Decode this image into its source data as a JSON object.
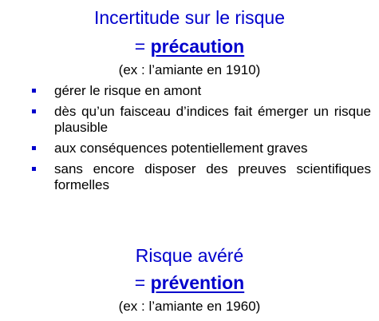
{
  "precaution": {
    "heading": "Incertitude sur le risque",
    "equals": "= ",
    "keyword": "précaution",
    "example": "(ex : l’amiante en 1910)",
    "bullets": [
      "gérer le risque en amont",
      "dès qu’un faisceau d’indices fait émerger un risque plausible",
      "aux conséquences potentiellement graves",
      "sans encore disposer des preuves scientifiques formelles"
    ]
  },
  "prevention": {
    "heading": "Risque avéré",
    "equals": "= ",
    "keyword": "prévention",
    "example": "(ex : l’amiante en 1960)"
  },
  "colors": {
    "heading_blue": "#0000CC",
    "bullet_blue": "#0000CC",
    "text": "#000000",
    "background": "#ffffff"
  }
}
